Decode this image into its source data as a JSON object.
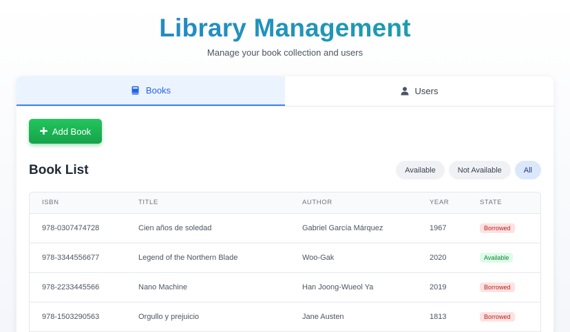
{
  "header": {
    "title": "Library Management",
    "subtitle": "Manage your book collection and users"
  },
  "tabs": [
    {
      "label": "Books",
      "icon": "book-icon",
      "active": true
    },
    {
      "label": "Users",
      "icon": "user-icon",
      "active": false
    }
  ],
  "toolbar": {
    "add_label": "Add Book"
  },
  "section": {
    "title": "Book List"
  },
  "filters": [
    {
      "label": "Available",
      "active": false
    },
    {
      "label": "Not Available",
      "active": false
    },
    {
      "label": "All",
      "active": true
    }
  ],
  "table": {
    "columns": [
      "ISBN",
      "TITLE",
      "AUTHOR",
      "YEAR",
      "STATE"
    ],
    "rows": [
      {
        "isbn": "978-0307474728",
        "title": "Cien años de soledad",
        "author": "Gabriel García Márquez",
        "year": "1967",
        "state": "Borrowed",
        "state_type": "borrowed"
      },
      {
        "isbn": "978-3344556677",
        "title": "Legend of the Northern Blade",
        "author": "Woo-Gak",
        "year": "2020",
        "state": "Available",
        "state_type": "available"
      },
      {
        "isbn": "978-2233445566",
        "title": "Nano Machine",
        "author": "Han Joong-Wueol Ya",
        "year": "2019",
        "state": "Borrowed",
        "state_type": "borrowed"
      },
      {
        "isbn": "978-1503290563",
        "title": "Orgullo y prejuicio",
        "author": "Jane Austen",
        "year": "1813",
        "state": "Borrowed",
        "state_type": "borrowed"
      }
    ]
  },
  "colors": {
    "accent": "#3b82f6",
    "add_button": "#16a34a",
    "borrowed": "#b42318",
    "available": "#15803d"
  }
}
